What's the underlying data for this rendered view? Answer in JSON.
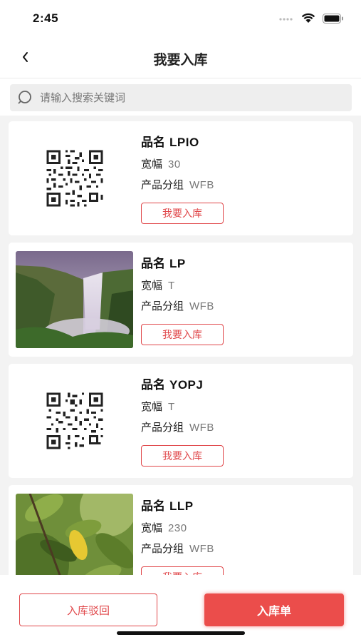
{
  "status_bar": {
    "time": "2:45"
  },
  "nav": {
    "title": "我要入库"
  },
  "search": {
    "placeholder": "请输入搜索关键词"
  },
  "labels": {
    "name": "品名",
    "width": "宽幅",
    "group": "产品分组",
    "action": "我要入库"
  },
  "items": [
    {
      "name": "LPIO",
      "width": "30",
      "group": "WFB",
      "image": "qr-code"
    },
    {
      "name": "LP",
      "width": "T",
      "group": "WFB",
      "image": "waterfall-photo"
    },
    {
      "name": "YOPJ",
      "width": "T",
      "group": "WFB",
      "image": "qr-code"
    },
    {
      "name": "LLP",
      "width": "230",
      "group": "WFB",
      "image": "leaf-photo"
    }
  ],
  "bottom": {
    "reject_label": "入库驳回",
    "order_label": "入库单"
  },
  "colors": {
    "accent": "#e0474a",
    "primary_button": "#eb4d4b"
  }
}
